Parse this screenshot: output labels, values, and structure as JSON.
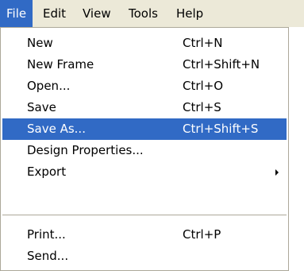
{
  "menubar": {
    "items": [
      {
        "label": "File"
      },
      {
        "label": "Edit"
      },
      {
        "label": "View"
      },
      {
        "label": "Tools"
      },
      {
        "label": "Help"
      }
    ]
  },
  "file_menu": {
    "items": [
      {
        "label": "New",
        "shortcut": "Ctrl+N"
      },
      {
        "label": "New Frame",
        "shortcut": "Ctrl+Shift+N"
      },
      {
        "label": "Open...",
        "shortcut": "Ctrl+O"
      },
      {
        "label": "Save",
        "shortcut": "Ctrl+S"
      },
      {
        "label": "Save As...",
        "shortcut": "Ctrl+Shift+S"
      },
      {
        "label": "Design Properties...",
        "shortcut": ""
      },
      {
        "label": "Export",
        "shortcut": ""
      },
      {
        "label": "Print...",
        "shortcut": "Ctrl+P"
      },
      {
        "label": "Send...",
        "shortcut": ""
      }
    ],
    "highlighted_item": "Save As..."
  },
  "colors": {
    "highlight": "#316ac5",
    "menubar_background": "#ece9d8",
    "menu_border": "#aca899"
  }
}
